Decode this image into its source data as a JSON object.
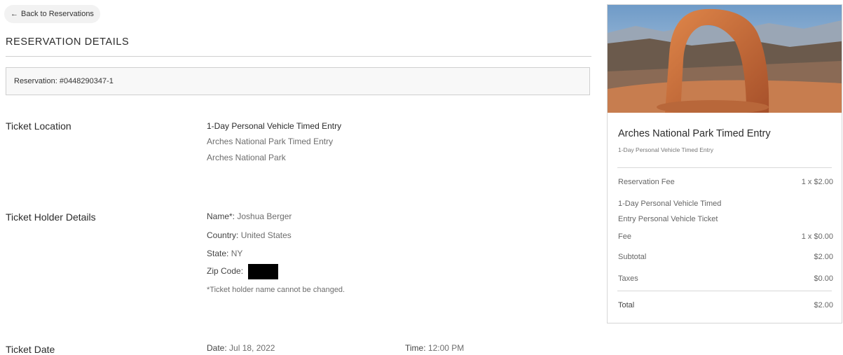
{
  "back": {
    "arrow": "←",
    "label": "Back to Reservations"
  },
  "page_title": "RESERVATION DETAILS",
  "reservation": {
    "label": "Reservation:",
    "number": "#0448290347-1"
  },
  "ticket_location": {
    "heading": "Ticket Location",
    "product": "1-Day Personal Vehicle Timed Entry",
    "facility": "Arches National Park Timed Entry",
    "park": "Arches National Park"
  },
  "holder": {
    "heading": "Ticket Holder Details",
    "name_label": "Name*:",
    "name": "Joshua Berger",
    "country_label": "Country:",
    "country": "United States",
    "state_label": "State:",
    "state": "NY",
    "zip_label": "Zip Code:",
    "note": "*Ticket holder name cannot be changed."
  },
  "ticket_date": {
    "heading": "Ticket Date",
    "date_label": "Date:",
    "date": "Jul 18, 2022",
    "time_label": "Time:",
    "time": "12:00 PM"
  },
  "summary": {
    "title": "Arches National Park Timed Entry",
    "subtitle": "1-Day Personal Vehicle Timed Entry",
    "reservation_fee_label": "Reservation Fee",
    "reservation_fee_amount": "1 x $2.00",
    "ticket_line1": "1-Day Personal Vehicle Timed",
    "ticket_line2": "Entry Personal Vehicle Ticket",
    "ticket_line3": "Fee",
    "ticket_amount": "1 x $0.00",
    "subtotal_label": "Subtotal",
    "subtotal": "$2.00",
    "taxes_label": "Taxes",
    "taxes": "$0.00",
    "total_label": "Total",
    "total": "$2.00"
  }
}
